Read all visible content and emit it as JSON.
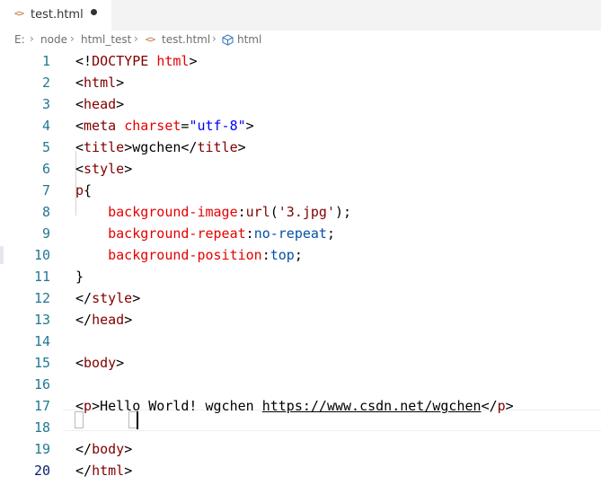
{
  "tab": {
    "icon": "code-brackets-icon",
    "icon_glyph": "<>",
    "title": "test.html"
  },
  "breadcrumb": {
    "items": [
      "E:",
      "node",
      "html_test",
      "test.html",
      "html"
    ],
    "file_icon": "code-brackets-icon",
    "element_icon": "cube-icon"
  },
  "editor": {
    "current_line": 20,
    "lines": [
      {
        "n": "1",
        "tokens": [
          [
            "p",
            "<!"
          ],
          [
            "t",
            "DOCTYPE"
          ],
          [
            "p",
            " "
          ],
          [
            "a",
            "html"
          ],
          [
            "p",
            ">"
          ]
        ]
      },
      {
        "n": "2",
        "tokens": [
          [
            "p",
            "<"
          ],
          [
            "t",
            "html"
          ],
          [
            "p",
            ">"
          ]
        ]
      },
      {
        "n": "3",
        "tokens": [
          [
            "p",
            "<"
          ],
          [
            "t",
            "head"
          ],
          [
            "p",
            ">"
          ]
        ]
      },
      {
        "n": "4",
        "tokens": [
          [
            "p",
            "<"
          ],
          [
            "t",
            "meta"
          ],
          [
            "p",
            " "
          ],
          [
            "a",
            "charset"
          ],
          [
            "p",
            "="
          ],
          [
            "v",
            "\"utf-8\""
          ],
          [
            "p",
            ">"
          ]
        ]
      },
      {
        "n": "5",
        "tokens": [
          [
            "p",
            "<"
          ],
          [
            "t",
            "title"
          ],
          [
            "p",
            ">wgchen</"
          ],
          [
            "t",
            "title"
          ],
          [
            "p",
            ">"
          ]
        ]
      },
      {
        "n": "6",
        "tokens": [
          [
            "p",
            "<"
          ],
          [
            "t",
            "style"
          ],
          [
            "p",
            ">"
          ]
        ]
      },
      {
        "n": "7",
        "tokens": [
          [
            "t",
            "p"
          ],
          [
            "p",
            "{"
          ]
        ]
      },
      {
        "n": "8",
        "tokens": [
          [
            "p",
            "    "
          ],
          [
            "prop",
            "background-image"
          ],
          [
            "p",
            ":"
          ],
          [
            "t",
            "url"
          ],
          [
            "p",
            "("
          ],
          [
            "t",
            "'3.jpg'"
          ],
          [
            "p",
            ");"
          ]
        ]
      },
      {
        "n": "9",
        "tokens": [
          [
            "p",
            "    "
          ],
          [
            "prop",
            "background-repeat"
          ],
          [
            "p",
            ":"
          ],
          [
            "val",
            "no-repeat"
          ],
          [
            "p",
            ";"
          ]
        ]
      },
      {
        "n": "10",
        "tokens": [
          [
            "p",
            "    "
          ],
          [
            "prop",
            "background-position"
          ],
          [
            "p",
            ":"
          ],
          [
            "val",
            "top"
          ],
          [
            "p",
            ";"
          ]
        ]
      },
      {
        "n": "11",
        "tokens": [
          [
            "p",
            "}"
          ]
        ]
      },
      {
        "n": "12",
        "tokens": [
          [
            "p",
            "</"
          ],
          [
            "t",
            "style"
          ],
          [
            "p",
            ">"
          ]
        ]
      },
      {
        "n": "13",
        "tokens": [
          [
            "p",
            "</"
          ],
          [
            "t",
            "head"
          ],
          [
            "p",
            ">"
          ]
        ]
      },
      {
        "n": "14",
        "tokens": []
      },
      {
        "n": "15",
        "tokens": [
          [
            "p",
            "<"
          ],
          [
            "t",
            "body"
          ],
          [
            "p",
            ">"
          ]
        ]
      },
      {
        "n": "16",
        "tokens": []
      },
      {
        "n": "17",
        "tokens": [
          [
            "p",
            "<"
          ],
          [
            "t",
            "p"
          ],
          [
            "p",
            ">Hello World! wgchen "
          ],
          [
            "link",
            "https://www.csdn.net/wgchen"
          ],
          [
            "p",
            "</"
          ],
          [
            "t",
            "p"
          ],
          [
            "p",
            ">"
          ]
        ]
      },
      {
        "n": "18",
        "tokens": []
      },
      {
        "n": "19",
        "tokens": [
          [
            "p",
            "</"
          ],
          [
            "t",
            "body"
          ],
          [
            "p",
            ">"
          ]
        ]
      },
      {
        "n": "20",
        "tokens": [
          [
            "p",
            "</"
          ],
          [
            "t",
            "html"
          ],
          [
            "p",
            ">"
          ]
        ]
      }
    ]
  }
}
